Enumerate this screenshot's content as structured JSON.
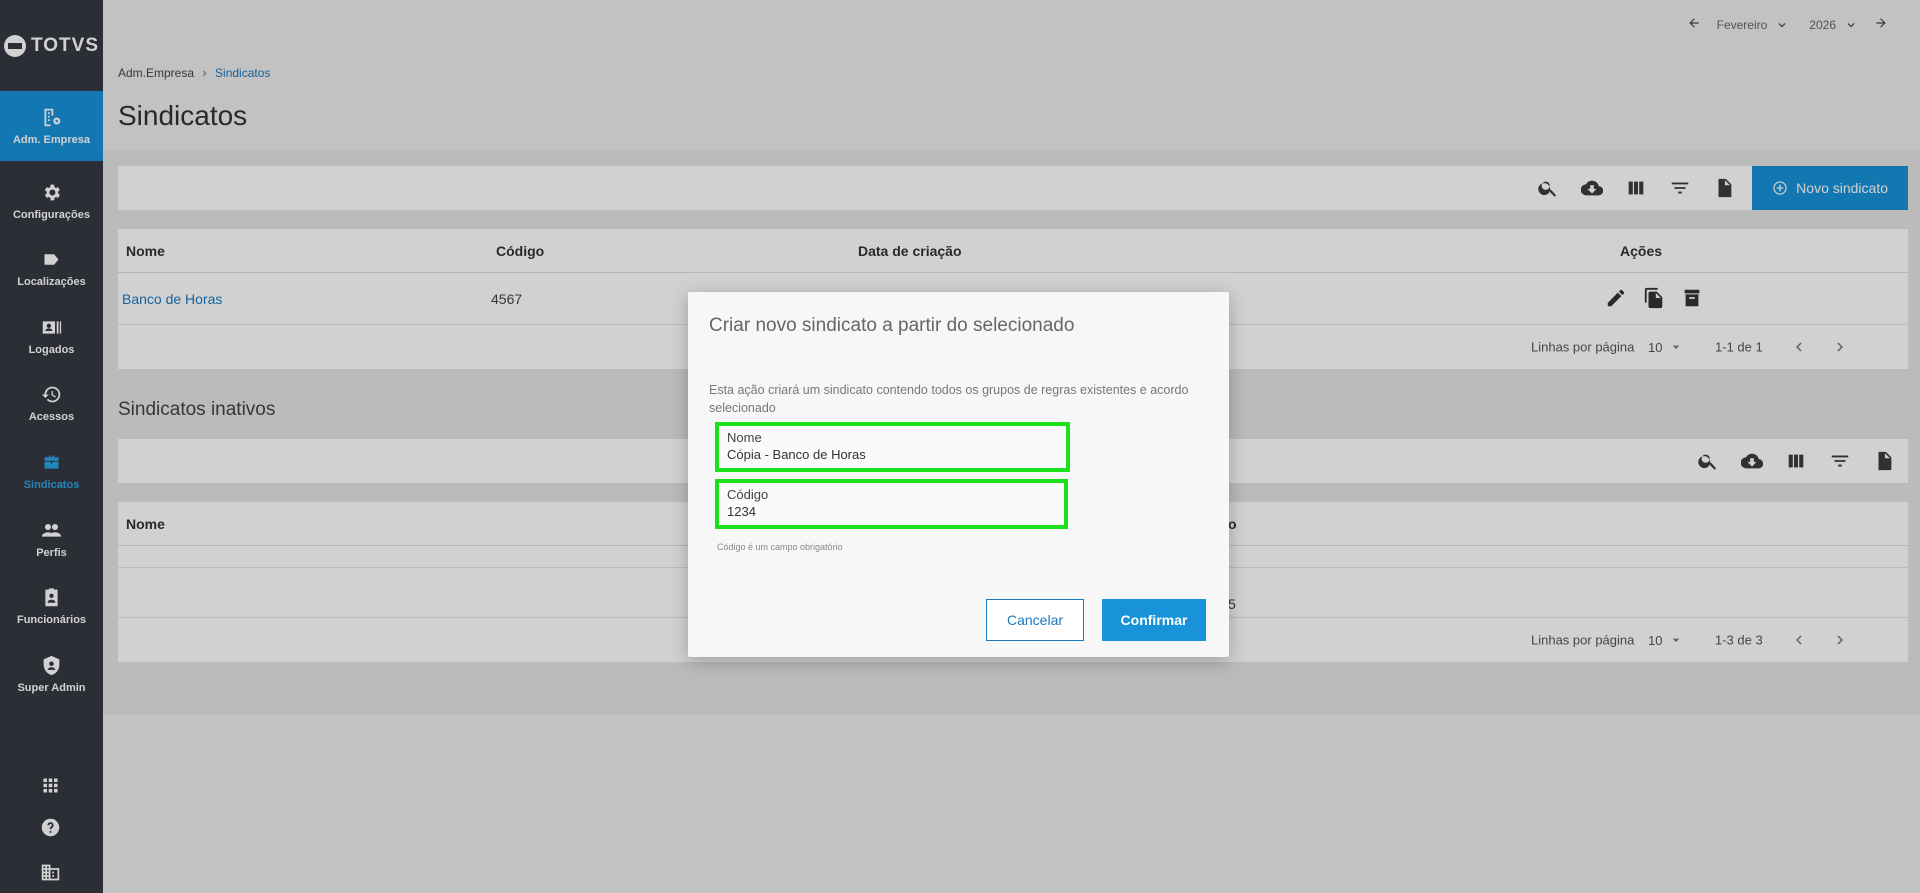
{
  "brand": {
    "logo_text": "TOTVS"
  },
  "sidebar": {
    "items": [
      {
        "label": "Adm. Empresa",
        "icon": "building-gear-icon"
      },
      {
        "label": "Configurações",
        "icon": "gear-icon"
      },
      {
        "label": "Localizações",
        "icon": "label-tag-icon"
      },
      {
        "label": "Logados",
        "icon": "id-badge-icon"
      },
      {
        "label": "Acessos",
        "icon": "history-icon"
      },
      {
        "label": "Sindicatos",
        "icon": "briefcase-icon"
      },
      {
        "label": "Perfis",
        "icon": "people-icon"
      },
      {
        "label": "Funcionários",
        "icon": "clipboard-person-icon"
      },
      {
        "label": "Super Admin",
        "icon": "shield-user-icon"
      }
    ],
    "bottom_icons": [
      "apps-grid-icon",
      "help-icon",
      "company-icon"
    ]
  },
  "header": {
    "month": "Fevereiro",
    "year": "2026"
  },
  "breadcrumb": {
    "parent": "Adm.Empresa",
    "current": "Sindicatos"
  },
  "page": {
    "title": "Sindicatos"
  },
  "toolbar": {
    "new_button": "Novo sindicato"
  },
  "active_table": {
    "columns": [
      "Nome",
      "Código",
      "Data de criação",
      "Ações"
    ],
    "rows": [
      {
        "nome": "Banco de Horas",
        "codigo": "4567"
      }
    ],
    "pager": {
      "rows_label": "Linhas por página",
      "rows_per_page": "10",
      "range": "1-1 de 1"
    }
  },
  "inactive_section": {
    "title": "Sindicatos inativos",
    "columns": [
      "Nome"
    ],
    "partial_header": "o",
    "partial_cell": "5",
    "pager": {
      "rows_label": "Linhas por página",
      "rows_per_page": "10",
      "range": "1-3 de 3"
    }
  },
  "modal": {
    "title": "Criar novo sindicato a partir do selecionado",
    "description": "Esta ação criará um sindicato contendo todos os grupos de regras existentes e acordo selecionado",
    "nome_label": "Nome",
    "nome_value": "Cópia - Banco de Horas",
    "codigo_label": "Código",
    "codigo_value": "1234",
    "hint": "Código é um campo obrigatório",
    "cancel": "Cancelar",
    "confirm": "Confirmar"
  },
  "colors": {
    "sidebar_bg": "#363943",
    "accent": "#1893d9",
    "link": "#1a79c0",
    "highlight": "#1de01d"
  }
}
